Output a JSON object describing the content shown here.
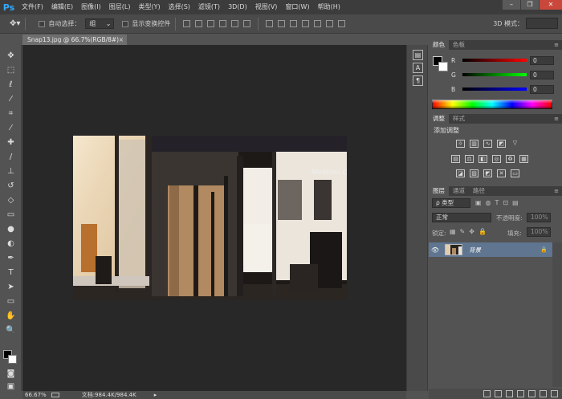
{
  "app": {
    "logo": "Ps"
  },
  "menu": [
    "文件(F)",
    "编辑(E)",
    "图像(I)",
    "图层(L)",
    "类型(Y)",
    "选择(S)",
    "滤镜(T)",
    "3D(D)",
    "视图(V)",
    "窗口(W)",
    "帮助(H)"
  ],
  "window_controls": [
    "minimize-icon",
    "restore-icon",
    "close-icon"
  ],
  "options": {
    "auto_select_label": "自动选择：",
    "auto_select_value": "组",
    "show_transform_label": "显示变换控件",
    "mode_3d_label": "3D 模式："
  },
  "document": {
    "tab_title": "Snap13.jpg @ 66.7%(RGB/8#)",
    "tab_close": "×",
    "zoom": "66.67%",
    "doc_info": "文档:984.4K/984.4K",
    "photo_sign": "Montana Oro"
  },
  "color_panel": {
    "tabs": [
      "颜色",
      "色板"
    ],
    "channels": [
      {
        "label": "R",
        "value": "0",
        "color": "#d63a3a"
      },
      {
        "label": "G",
        "value": "0",
        "color": "#3fbf3f"
      },
      {
        "label": "B",
        "value": "0",
        "color": "#3a6ad6"
      }
    ]
  },
  "adjust_panel": {
    "tabs": [
      "调整",
      "样式"
    ],
    "add_label": "添加调整"
  },
  "layers_panel": {
    "tabs": [
      "图层",
      "通道",
      "路径"
    ],
    "filter_label": "ρ 类型",
    "blend_mode": "正常",
    "opacity_label": "不透明度:",
    "opacity_value": "100%",
    "lock_label": "锁定:",
    "fill_label": "填充:",
    "fill_value": "100%",
    "layers": [
      {
        "name": "背景",
        "visible": true,
        "locked": true
      }
    ]
  },
  "colors": {
    "accent_blue": "#32a9ff",
    "selected_layer": "#5f7590",
    "canvas_bg": "#282828"
  },
  "panel_menu_glyph": "≡"
}
